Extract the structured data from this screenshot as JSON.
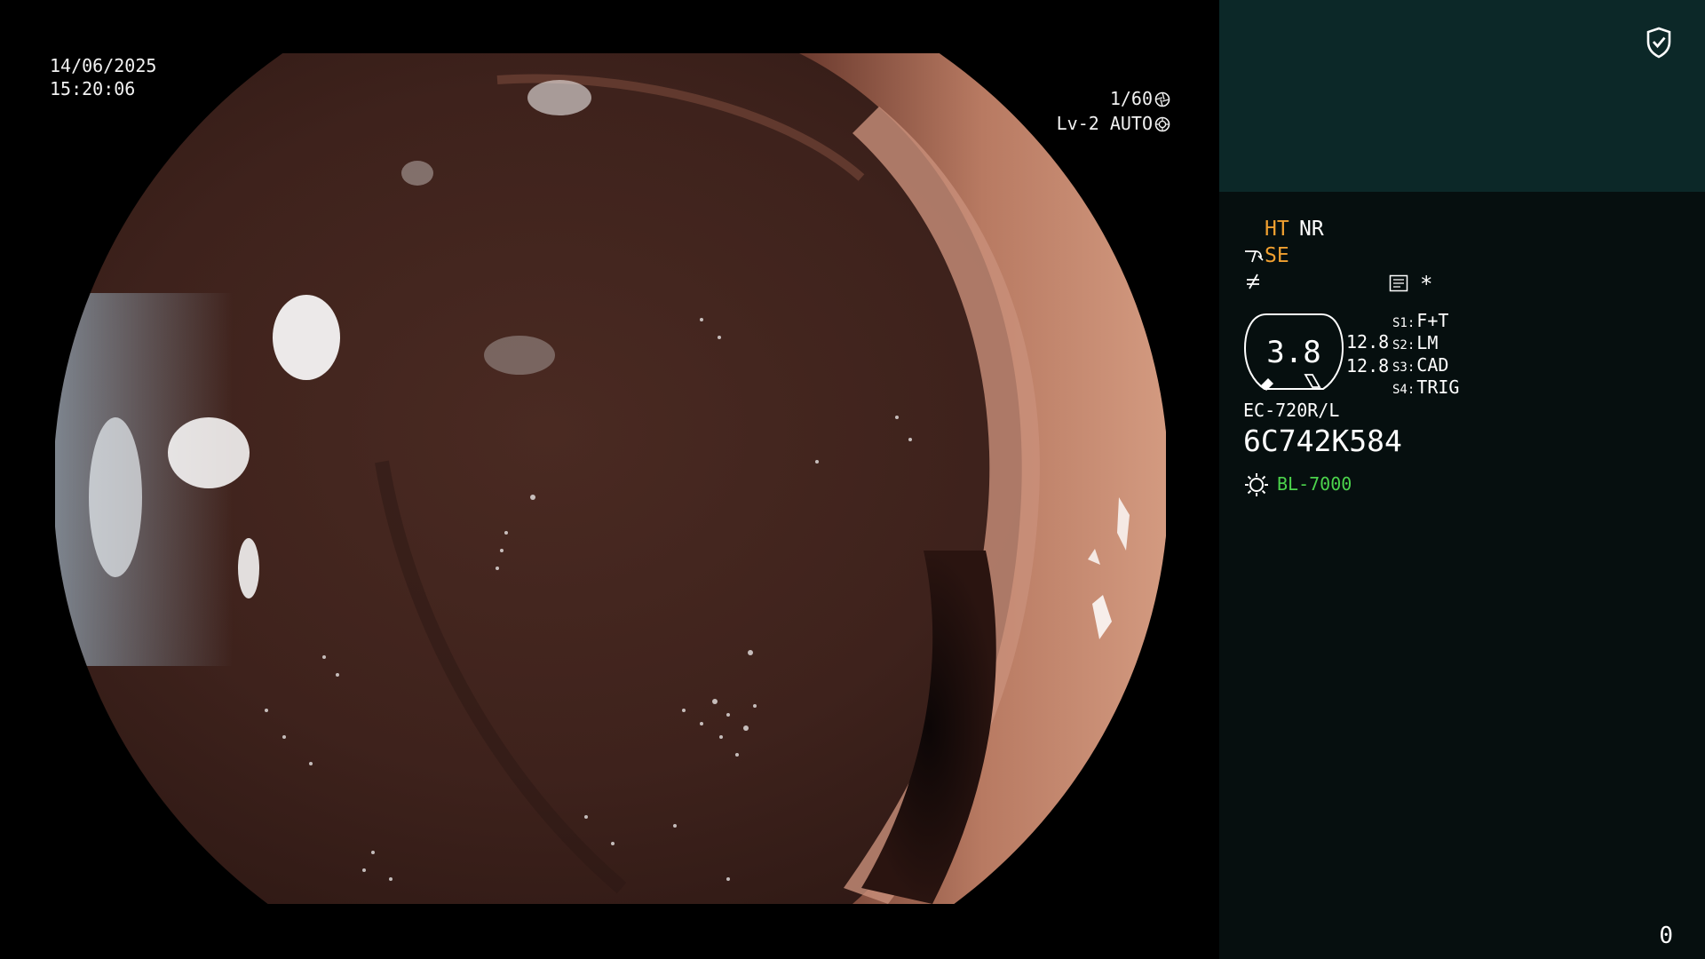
{
  "video": {
    "date": "14/06/2025",
    "time": "15:20:06",
    "shutter": "1/60",
    "level": "Lv-2 AUTO"
  },
  "panel": {
    "modes": {
      "ht": "HT",
      "nr": "NR",
      "se": "SE"
    },
    "asterisk": "*",
    "zoom": "3.8",
    "ratio_top": "12.8",
    "ratio_bottom": "12.8",
    "switches": [
      {
        "key": "S1:",
        "value": "F+T"
      },
      {
        "key": "S2:",
        "value": "LM"
      },
      {
        "key": "S3:",
        "value": "CAD"
      },
      {
        "key": "S4:",
        "value": "TRIG"
      }
    ],
    "scope_model": "EC-720R/L",
    "serial": "6C742K584",
    "light_source": "BL-7000",
    "counter": "0"
  },
  "colors": {
    "panel_top": "#0c2828",
    "panel_bottom": "#060f0f",
    "mode_accent": "#f0a030",
    "light_source": "#4cd34c"
  },
  "icons": [
    "shield-check-icon",
    "shutter-icon",
    "iris-icon",
    "scope-mini-icon",
    "not-equal-icon",
    "memo-icon",
    "light-source-icon"
  ]
}
